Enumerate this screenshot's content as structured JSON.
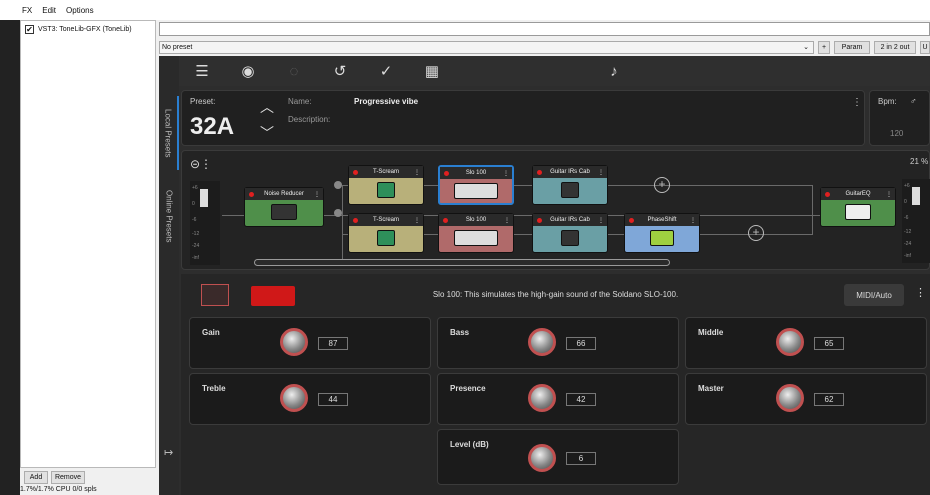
{
  "menu": [
    "FX",
    "Edit",
    "Options"
  ],
  "fx_list": {
    "item": "VST3: ToneLib-GFX (ToneLib)",
    "checked": true
  },
  "bottom": {
    "add": "Add",
    "remove": "Remove",
    "cpu": "1.7%/1.7% CPU 0/0 spls"
  },
  "preset_bar": {
    "preset": "No preset",
    "plus": "+",
    "param": "Param",
    "io": "2 in 2 out",
    "u": "U"
  },
  "side_tabs": {
    "local": "Local Presets",
    "online": "Online Presets"
  },
  "toolbar": {
    "icons": [
      "menu-icon",
      "back-icon",
      "reload-icon",
      "undo-icon",
      "check-icon",
      "save-icon",
      "tuner-icon"
    ]
  },
  "preset": {
    "label": "Preset:",
    "number": "32A",
    "name_label": "Name:",
    "name": "Progressive vibe",
    "desc_label": "Description:",
    "bpm_label": "Bpm:",
    "bpm": "120"
  },
  "chain": {
    "input_meter": [
      "+6",
      "0",
      "-6",
      "-12",
      "-24",
      "-inf"
    ],
    "output_meter": [
      "+6",
      "0",
      "-6",
      "-12",
      "-24",
      "-inf"
    ],
    "output_pct": "21 %",
    "noise_reducer": "Noise Reducer",
    "row1": [
      "T-Scream",
      "Slo 100",
      "Guitar IRs Cab"
    ],
    "row2": [
      "T-Scream",
      "Slo 100",
      "Guitar IRs Cab",
      "PhaseShift"
    ],
    "guitareq": "GuitarEQ"
  },
  "detail": {
    "description": "Slo 100:  This simulates the high-gain sound of the Soldano SLO-100.",
    "midi": "MIDI/Auto",
    "knobs": [
      {
        "label": "Gain",
        "value": "87"
      },
      {
        "label": "Bass",
        "value": "66"
      },
      {
        "label": "Middle",
        "value": "65"
      },
      {
        "label": "Treble",
        "value": "44"
      },
      {
        "label": "Presence",
        "value": "42"
      },
      {
        "label": "Master",
        "value": "62"
      },
      {
        "label": "Level (dB)",
        "value": "6"
      }
    ]
  },
  "colors": {
    "accent": "#2a7fd1",
    "led": "#e02020",
    "green": "#4f8f4a",
    "khaki": "#b8b07a",
    "red": "#b06a6a",
    "teal": "#6a9fa5",
    "blue": "#7fa7d8"
  }
}
